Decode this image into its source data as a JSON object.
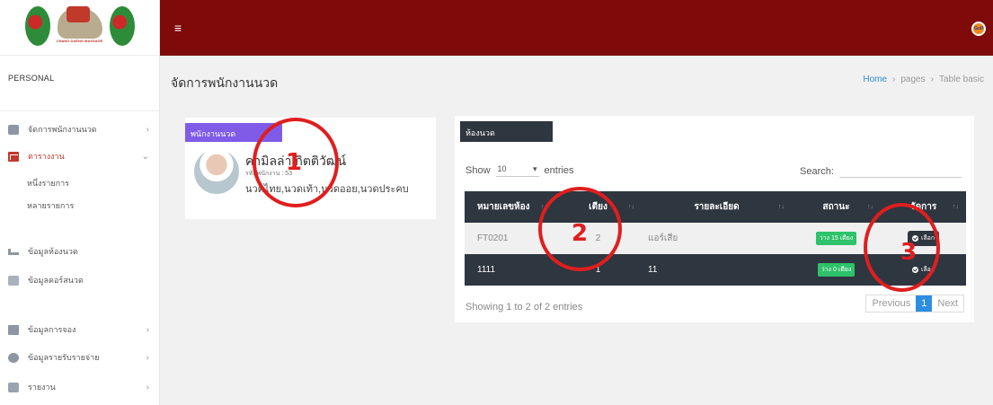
{
  "sidebar": {
    "logo_text": "CHANG DAENG MASSAGE",
    "heading": "PERSONAL",
    "items": [
      {
        "label": "จัดการพนักงานนวด",
        "chevron": "›"
      },
      {
        "label": "ตารางงาน",
        "chevron": "⌄"
      },
      {
        "label": "ข้อมูลห้องนวด"
      },
      {
        "label": "ข้อมูลคอร์สนวด"
      },
      {
        "label": "ข้อมูลการจอง",
        "chevron": "›"
      },
      {
        "label": "ข้อมูลรายรับรายจ่าย",
        "chevron": "›"
      },
      {
        "label": "รายงาน",
        "chevron": "›"
      }
    ],
    "subitems": [
      "หนึ่งรายการ",
      "หลายรายการ"
    ]
  },
  "topbar": {
    "menu_icon": "≡",
    "brand_badge": "Gulf"
  },
  "page": {
    "title": "จัดการพนักงานนวด",
    "breadcrumb": [
      "Home",
      "›",
      "pages",
      "›",
      "Table basic"
    ]
  },
  "staff": {
    "tag": "พนักงานนวด",
    "name": "คามิลล่า กิตติวัฒน์",
    "id_line": "รหัสพนักงาน : 53",
    "skills": "นวดไทย,นวดเท้า,นวดออย,นวดประคบ"
  },
  "rooms": {
    "tag": "ห้องนวด",
    "show_label": "Show",
    "length_value": "10",
    "entries_label": "entries",
    "search_label": "Search:",
    "columns": [
      "หมายเลขห้อง",
      "เตียง",
      "รายละเอียด",
      "สถานะ",
      "จัดการ"
    ],
    "rows": [
      {
        "room": "FT0201",
        "beds": "2",
        "detail": "แอร์เสีย",
        "status": "ว่าง 15 เตียง",
        "action": "เลือก"
      },
      {
        "room": "1111",
        "beds": "1",
        "detail": "11",
        "status": "ว่าง 0 เตียง",
        "action": "เลือก"
      }
    ],
    "showing": "Showing 1 to 2 of 2 entries",
    "pager": {
      "prev": "Previous",
      "page": "1",
      "next": "Next"
    }
  },
  "annotations": [
    "1",
    "2",
    "3"
  ],
  "colors": {
    "topbar": "#7e0a0a",
    "staff_tag": "#7f5be8",
    "dark": "#2e3640",
    "badge": "#2ec26a",
    "annotation": "#e01e1e"
  }
}
